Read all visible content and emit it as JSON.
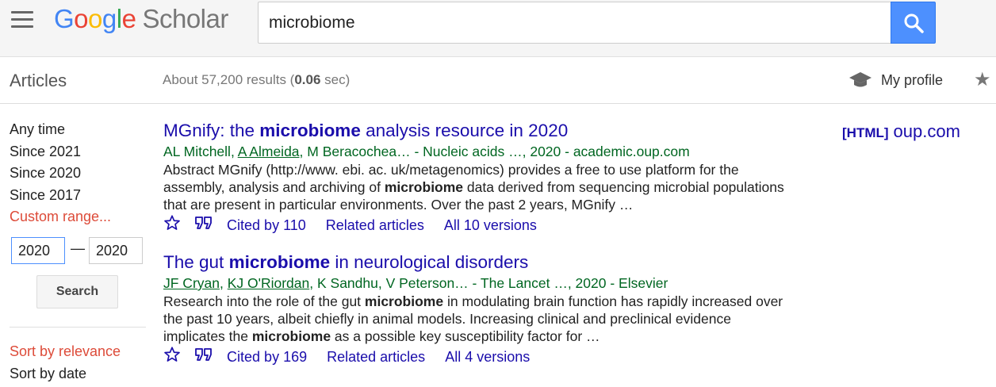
{
  "header": {
    "logo": {
      "google": [
        "G",
        "o",
        "o",
        "g",
        "l",
        "e"
      ],
      "scholar": "Scholar"
    },
    "search_query": "microbiome"
  },
  "subbar": {
    "articles_label": "Articles",
    "results_prefix": "About 57,200 results (",
    "results_time": "0.06",
    "results_suffix": " sec)",
    "profile_label": "My profile"
  },
  "sidebar": {
    "time_filters": [
      "Any time",
      "Since 2021",
      "Since 2020",
      "Since 2017"
    ],
    "custom_range": "Custom range...",
    "year_from": "2020",
    "year_to": "2020",
    "dash": "—",
    "search_button": "Search",
    "sort_relevance": "Sort by relevance",
    "sort_date": "Sort by date"
  },
  "results": [
    {
      "title_pre": "MGnify: the ",
      "title_bold": "microbiome",
      "title_post": " analysis resource in 2020",
      "authors": [
        {
          "name": "AL Mitchell",
          "linked": false
        },
        {
          "name": "A Almeida",
          "linked": true
        },
        {
          "name": "M Beracochea",
          "linked": false
        }
      ],
      "meta_tail": "… - Nucleic acids …, 2020 - academic.oup.com",
      "snippet_1": "Abstract MGnify (http://www. ebi. ac. uk/metagenomics) provides a free to use platform for the assembly, analysis and archiving of ",
      "snippet_bold_1": "microbiome",
      "snippet_2": " data derived from sequencing microbial populations that are present in particular environments. Over the past 2 years, MGnify …",
      "snippet_bold_2": "",
      "snippet_3": "",
      "cited_by": "Cited by 110",
      "related": "Related articles",
      "versions": "All 10 versions",
      "side_tag": "[HTML]",
      "side_source": "oup.com"
    },
    {
      "title_pre": "The gut ",
      "title_bold": "microbiome",
      "title_post": " in neurological disorders",
      "authors": [
        {
          "name": "JF Cryan",
          "linked": true
        },
        {
          "name": "KJ O'Riordan",
          "linked": true
        },
        {
          "name": "K Sandhu",
          "linked": false
        },
        {
          "name": "V Peterson",
          "linked": false
        }
      ],
      "meta_tail": "… - The Lancet …, 2020 - Elsevier",
      "snippet_1": "Research into the role of the gut ",
      "snippet_bold_1": "microbiome",
      "snippet_2": " in modulating brain function has rapidly increased over the past 10 years, albeit chiefly in animal models. Increasing clinical and preclinical evidence implicates the ",
      "snippet_bold_2": "microbiome",
      "snippet_3": " as a possible key susceptibility factor for …",
      "cited_by": "Cited by 169",
      "related": "Related articles",
      "versions": "All 4 versions"
    }
  ],
  "colors": {
    "link": "#1a0dab",
    "green": "#006621",
    "accent_red": "#dd4b39",
    "search_blue": "#4d90fe"
  },
  "icons": [
    "menu-icon",
    "search-icon",
    "graduation-cap-icon",
    "star-icon",
    "save-star-icon",
    "quote-icon"
  ]
}
